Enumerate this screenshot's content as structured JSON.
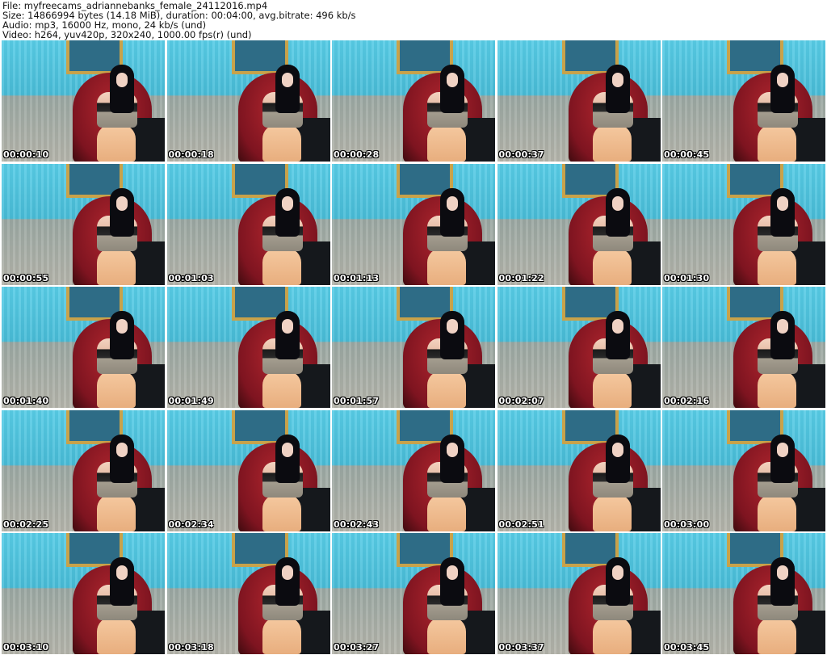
{
  "header": {
    "file": "File: myfreecams_adriannebanks_female_24112016.mp4",
    "size": "Size: 14866994 bytes (14.18 MiB), duration: 00:04:00, avg.bitrate: 496 kb/s",
    "audio": "Audio: mp3, 16000 Hz, mono, 24 kb/s (und)",
    "video": "Video: h264, yuv420p, 320x240, 1000.00 fps(r) (und)"
  },
  "thumbnails": [
    {
      "timestamp": "00:00:10"
    },
    {
      "timestamp": "00:00:18"
    },
    {
      "timestamp": "00:00:28"
    },
    {
      "timestamp": "00:00:37"
    },
    {
      "timestamp": "00:00:45"
    },
    {
      "timestamp": "00:00:55"
    },
    {
      "timestamp": "00:01:03"
    },
    {
      "timestamp": "00:01:13"
    },
    {
      "timestamp": "00:01:22"
    },
    {
      "timestamp": "00:01:30"
    },
    {
      "timestamp": "00:01:40"
    },
    {
      "timestamp": "00:01:49"
    },
    {
      "timestamp": "00:01:57"
    },
    {
      "timestamp": "00:02:07"
    },
    {
      "timestamp": "00:02:16"
    },
    {
      "timestamp": "00:02:25"
    },
    {
      "timestamp": "00:02:34"
    },
    {
      "timestamp": "00:02:43"
    },
    {
      "timestamp": "00:02:51"
    },
    {
      "timestamp": "00:03:00"
    },
    {
      "timestamp": "00:03:10"
    },
    {
      "timestamp": "00:03:18"
    },
    {
      "timestamp": "00:03:27"
    },
    {
      "timestamp": "00:03:37"
    },
    {
      "timestamp": "00:03:45"
    }
  ]
}
